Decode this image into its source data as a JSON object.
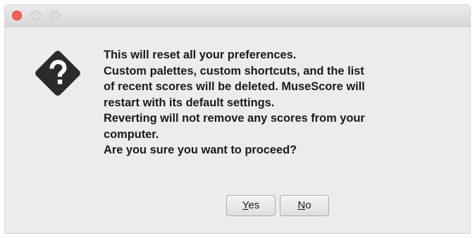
{
  "window": {
    "controls": [
      "close",
      "minimize",
      "zoom"
    ]
  },
  "dialog": {
    "icon": "question-diamond-icon",
    "message_lines": [
      "This will reset all your preferences.",
      "Custom palettes, custom shortcuts, and the list",
      "of recent scores will be deleted. MuseScore will",
      "restart with its default settings.",
      "Reverting will not remove any scores from your",
      "computer.",
      "Are you sure you want to proceed?"
    ],
    "buttons": {
      "yes": {
        "mnemonic": "Y",
        "rest": "es"
      },
      "no": {
        "mnemonic": "N",
        "rest": "o"
      }
    }
  },
  "colors": {
    "close_light": "#fc605c",
    "inactive_light": "#dcdcdc",
    "icon_dark": "#2b2b2b",
    "window_bg": "#ececec"
  }
}
